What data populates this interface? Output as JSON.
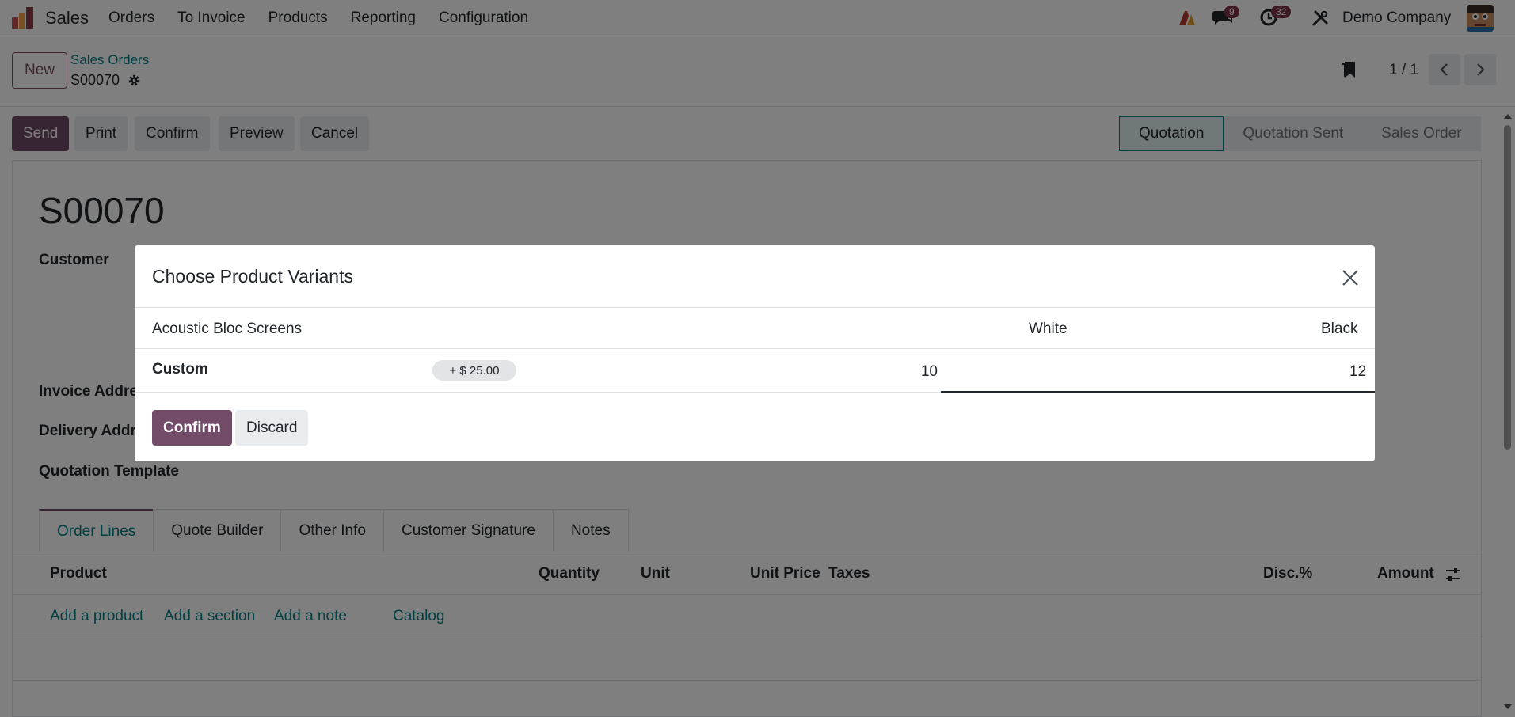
{
  "navbar": {
    "app_name": "Sales",
    "menu": [
      "Orders",
      "To Invoice",
      "Products",
      "Reporting",
      "Configuration"
    ],
    "messages_count": "9",
    "activities_count": "32",
    "company": "Demo Company"
  },
  "control_panel": {
    "new_label": "New",
    "breadcrumb_parent": "Sales Orders",
    "breadcrumb_current": "S00070",
    "pager_value": "1 / 1"
  },
  "actions": {
    "send": "Send",
    "print": "Print",
    "confirm": "Confirm",
    "preview": "Preview",
    "cancel": "Cancel"
  },
  "stages": [
    "Quotation",
    "Quotation Sent",
    "Sales Order"
  ],
  "form": {
    "record_name": "S00070",
    "customer_label": "Customer",
    "invoice_address_label": "Invoice Address",
    "delivery_address_label": "Delivery Address",
    "quotation_template_label": "Quotation Template",
    "tabs": [
      "Order Lines",
      "Quote Builder",
      "Other Info",
      "Customer Signature",
      "Notes"
    ],
    "columns": {
      "product": "Product",
      "quantity": "Quantity",
      "unit": "Unit",
      "unit_price": "Unit Price",
      "taxes": "Taxes",
      "disc": "Disc.%",
      "amount": "Amount"
    },
    "add_links": {
      "add_product": "Add a product",
      "add_section": "Add a section",
      "add_note": "Add a note",
      "catalog": "Catalog"
    }
  },
  "modal": {
    "title": "Choose Product Variants",
    "product_name": "Acoustic Bloc Screens",
    "attr_white": "White",
    "attr_black": "Black",
    "row_label": "Custom",
    "row_extra_price": "+ $ 25.00",
    "white_qty": "10",
    "black_qty": "12",
    "confirm": "Confirm",
    "discard": "Discard"
  },
  "colors": {
    "primary": "#714b67",
    "link": "#017e84",
    "badge": "#7c3045"
  }
}
